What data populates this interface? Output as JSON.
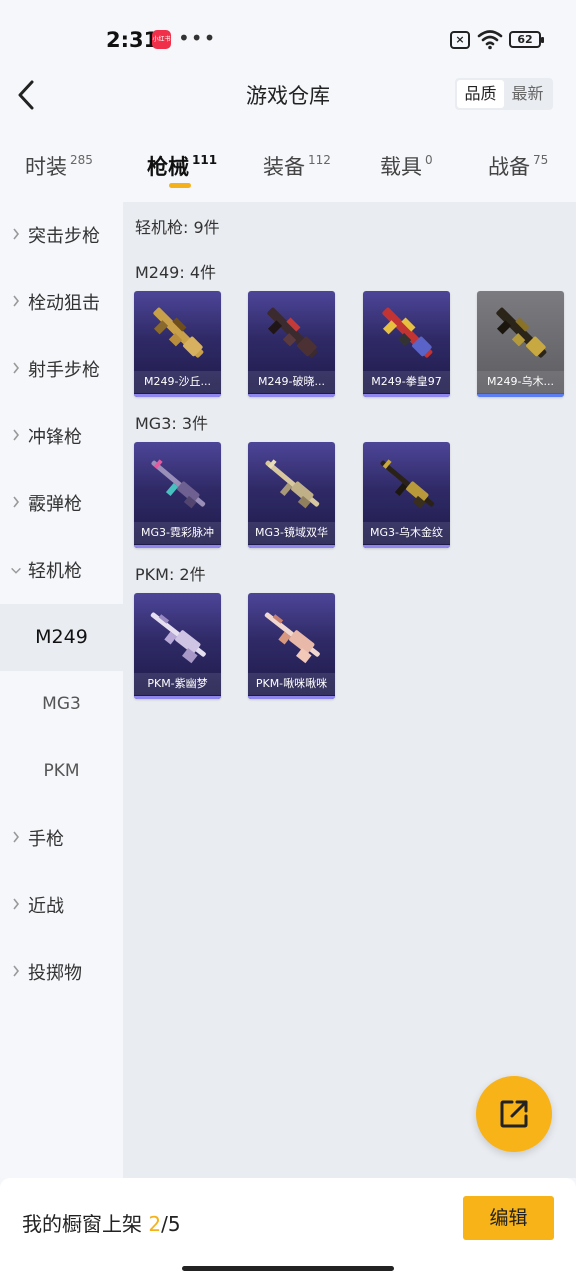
{
  "status_bar": {
    "time": "2:31",
    "app_badge": "小红书",
    "more": "•••",
    "battery": "62"
  },
  "header": {
    "title": "游戏仓库",
    "sort_options": [
      "品质",
      "最新"
    ]
  },
  "tabs": [
    {
      "label": "时装",
      "count": "285"
    },
    {
      "label": "枪械",
      "count": "111"
    },
    {
      "label": "装备",
      "count": "112"
    },
    {
      "label": "载具",
      "count": "0"
    },
    {
      "label": "战备",
      "count": "75"
    }
  ],
  "sidebar": {
    "items": [
      {
        "label": "突击步枪"
      },
      {
        "label": "栓动狙击"
      },
      {
        "label": "射手步枪"
      },
      {
        "label": "冲锋枪"
      },
      {
        "label": "霰弹枪"
      },
      {
        "label": "轻机枪"
      },
      {
        "label": "手枪"
      },
      {
        "label": "近战"
      },
      {
        "label": "投掷物"
      }
    ],
    "sub_items": [
      "M249",
      "MG3",
      "PKM"
    ]
  },
  "main": {
    "category_title": "轻机枪: 9件",
    "groups": [
      {
        "title": "M249: 4件",
        "items": [
          "M249-沙丘...",
          "M249-破晓...",
          "M249-拳皇97",
          "M249-乌木..."
        ]
      },
      {
        "title": "MG3: 3件",
        "items": [
          "MG3-霓彩脉冲",
          "MG3-镜域双华",
          "MG3-乌木金纹"
        ]
      },
      {
        "title": "PKM: 2件",
        "items": [
          "PKM-紫幽梦",
          "PKM-啾咪啾咪"
        ]
      }
    ]
  },
  "bottom": {
    "showcase_label": "我的橱窗上架",
    "showcase_current": "2",
    "showcase_total": "/5",
    "edit_label": "编辑"
  },
  "colors": {
    "accent": "#f7b318",
    "card_bg": "#2f2a66"
  }
}
